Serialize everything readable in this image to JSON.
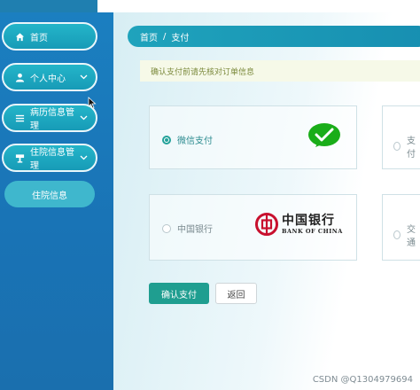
{
  "sidebar": {
    "items": [
      {
        "label": "首页",
        "icon": "home-icon"
      },
      {
        "label": "个人中心",
        "icon": "user-icon"
      },
      {
        "label": "病历信息管理",
        "icon": "list-icon"
      },
      {
        "label": "住院信息管理",
        "icon": "bed-icon"
      }
    ],
    "sub_item": "住院信息"
  },
  "breadcrumb": {
    "home": "首页",
    "separator": "/",
    "current": "支付"
  },
  "notice": "确认支付前请先核对订单信息",
  "payment": {
    "options": [
      {
        "label": "微信支付",
        "selected": true,
        "logo": "wechat-pay-logo"
      },
      {
        "label": "中国银行",
        "selected": false,
        "logo": "bank-of-china-logo"
      }
    ],
    "partial_right": [
      "支付",
      "交通"
    ],
    "boc_cn": "中国银行",
    "boc_en": "BANK OF CHINA"
  },
  "buttons": {
    "confirm": "确认支付",
    "back": "返回"
  },
  "watermark": "CSDN @Q1304979694",
  "colors": {
    "sidebar": "#1b7fc0",
    "accent": "#1f9e90",
    "wechat_green": "#1aad19",
    "boc_red": "#c8102e"
  }
}
